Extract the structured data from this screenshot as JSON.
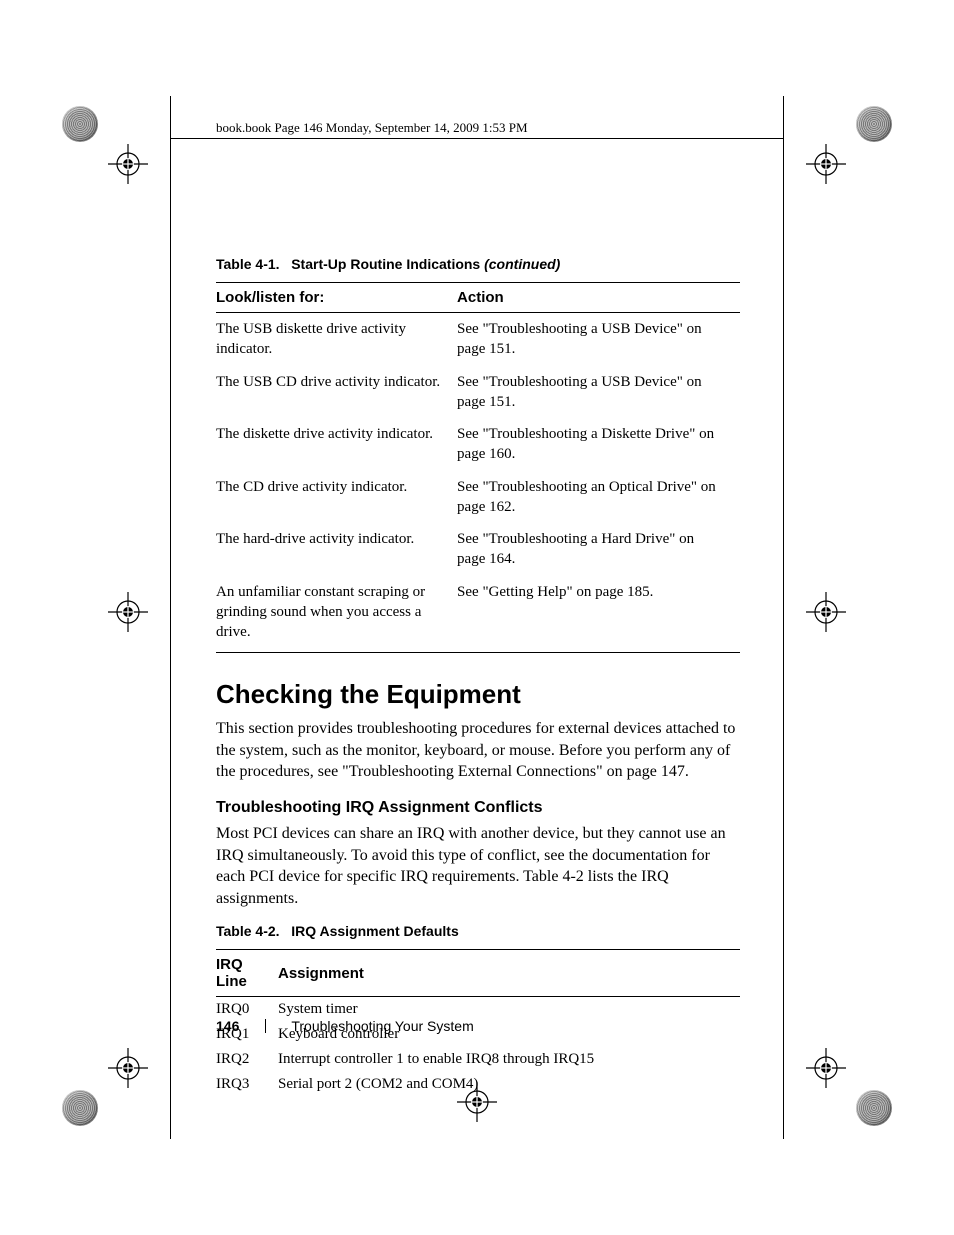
{
  "running_header": "book.book  Page 146  Monday, September 14, 2009  1:53 PM",
  "table1": {
    "caption_label": "Table 4-1.",
    "caption_title": "Start-Up Routine Indications ",
    "caption_suffix": "(continued)",
    "head_look": "Look/listen for:",
    "head_action": "Action",
    "rows": [
      {
        "look": "The USB diskette drive activity indicator.",
        "action": "See \"Troubleshooting a USB Device\" on page 151."
      },
      {
        "look": "The USB CD drive activity indicator.",
        "action": "See \"Troubleshooting a USB Device\" on page 151."
      },
      {
        "look": "The diskette drive activity indicator.",
        "action": "See \"Troubleshooting a Diskette Drive\" on page 160."
      },
      {
        "look": "The CD drive activity indicator.",
        "action": "See \"Troubleshooting an Optical Drive\" on page 162."
      },
      {
        "look": "The hard-drive activity indicator.",
        "action": "See \"Troubleshooting a Hard Drive\" on page 164."
      },
      {
        "look": "An unfamiliar constant scraping or grinding sound when you access a drive.",
        "action": "See \"Getting Help\" on page 185."
      }
    ]
  },
  "heading": "Checking the Equipment",
  "para1": "This section provides troubleshooting procedures for external devices attached to the system, such as the monitor, keyboard, or mouse. Before you perform any of the procedures, see \"Troubleshooting External Connections\" on page 147.",
  "subheading": "Troubleshooting IRQ Assignment Conflicts",
  "para2": "Most PCI devices can share an IRQ with another device, but they cannot use an IRQ simultaneously. To avoid this type of conflict, see the documentation for each PCI device for specific IRQ requirements. Table 4-2 lists the IRQ assignments.",
  "table2": {
    "caption_label": "Table 4-2.",
    "caption_title": "IRQ Assignment Defaults",
    "head_irq": "IRQ Line",
    "head_assign": "Assignment",
    "rows": [
      {
        "irq": "IRQ0",
        "assign": "System timer"
      },
      {
        "irq": "IRQ1",
        "assign": "Keyboard controller"
      },
      {
        "irq": "IRQ2",
        "assign": "Interrupt controller 1 to enable IRQ8 through IRQ15"
      },
      {
        "irq": "IRQ3",
        "assign": "Serial port 2 (COM2 and COM4)"
      }
    ]
  },
  "footer": {
    "page_number": "146",
    "section": "Troubleshooting Your System"
  }
}
